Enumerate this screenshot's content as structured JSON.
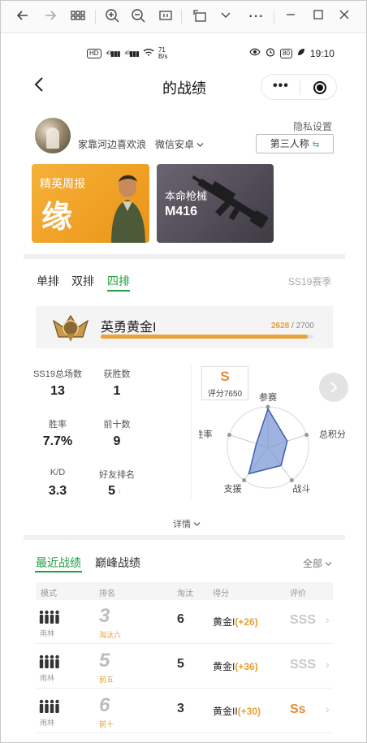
{
  "browser": {
    "back_icon": "arrow-left-icon",
    "forward_icon": "arrow-right-icon",
    "grid_icon": "grid-icon"
  },
  "status_bar": {
    "hd_badge": "HD",
    "net_speed_value": "71",
    "net_speed_unit": "B/s",
    "battery": "80",
    "time": "19:10"
  },
  "header": {
    "title": "的战绩"
  },
  "user": {
    "name": "家靠河边喜欢浪",
    "platform": "微信安卓",
    "privacy_label": "隐私设置",
    "view_mode": "第三人称"
  },
  "cards": {
    "weekly_label": "精英周报",
    "weekly_big": "缘",
    "gun_label": "本命枪械",
    "gun_name": "M416"
  },
  "modes": {
    "tabs": [
      "单排",
      "双排",
      "四排"
    ],
    "active": "四排",
    "season": "SS19赛季"
  },
  "rank": {
    "name": "英勇黄金I",
    "current": "2628",
    "max": "/ 2700",
    "progress": 0.973
  },
  "stats": [
    {
      "label": "SS19总场数",
      "value": "13"
    },
    {
      "label": "获胜数",
      "value": "1"
    },
    {
      "label": "胜率",
      "value": "7.7%"
    },
    {
      "label": "前十数",
      "value": "9"
    },
    {
      "label": "K/D",
      "value": "3.3"
    },
    {
      "label": "好友排名",
      "value": "5"
    }
  ],
  "score": {
    "grade": "S",
    "text": "评分7650"
  },
  "radar": {
    "axes": [
      "参赛",
      "总积分",
      "战斗",
      "支援",
      "胜率"
    ],
    "values": [
      0.95,
      0.5,
      0.55,
      0.8,
      0.3
    ]
  },
  "details_label": "详情",
  "recent": {
    "tabs": [
      "最近战绩",
      "巅峰战绩"
    ],
    "active": "最近战绩",
    "filter": "全部",
    "columns": [
      "模式",
      "排名",
      "淘汰",
      "得分",
      "评价"
    ],
    "rows": [
      {
        "map": "雨林",
        "place": "3",
        "tag": "淘汰六",
        "kills": "6",
        "tier": "黄金I",
        "delta": "(+26)",
        "rating": "SSS",
        "hot": false
      },
      {
        "map": "雨林",
        "place": "5",
        "tag": "前五",
        "kills": "5",
        "tier": "黄金I",
        "delta": "(+36)",
        "rating": "SSS",
        "hot": false
      },
      {
        "map": "雨林",
        "place": "6",
        "tag": "前十",
        "kills": "3",
        "tier": "黄金II",
        "delta": "(+30)",
        "rating": "Ss",
        "hot": true
      }
    ]
  },
  "colors": {
    "accent_green": "#22a042",
    "gold": "#e7a02f",
    "orange": "#e98a3a",
    "radar_fill": "#7d9ad6"
  }
}
